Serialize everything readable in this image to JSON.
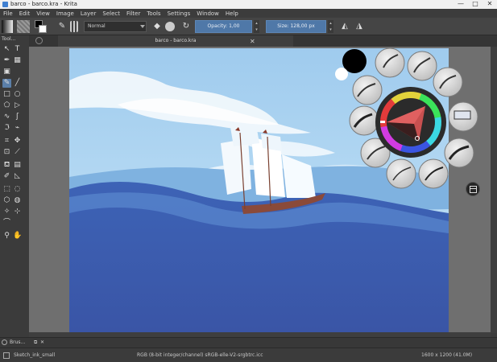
{
  "window": {
    "title": "barco - barco.kra  -  Krita",
    "controls": [
      "—",
      "□",
      "✕"
    ]
  },
  "menu": [
    "File",
    "Edit",
    "View",
    "Image",
    "Layer",
    "Select",
    "Filter",
    "Tools",
    "Settings",
    "Window",
    "Help"
  ],
  "tool_options": {
    "blend_mode": "Normal",
    "opacity_label": "Opacity: 1,00",
    "size_label": "Size: 128,00 px"
  },
  "toolbox": {
    "title": "Tool...",
    "icons": [
      "arrow-select-icon",
      "text-tool-icon",
      "calligraphy-icon",
      "multibrush-icon",
      "transform-icon",
      "brush-tool-icon",
      "line-tool-icon",
      "rectangle-tool-icon",
      "ellipse-tool-icon",
      "polygon-tool-icon",
      "polyline-tool-icon",
      "bezier-tool-icon",
      "freehand-path-icon",
      "dynamic-brush-icon",
      "crop-icon",
      "move-icon",
      "fill-icon",
      "gradient-icon",
      "color-picker-icon",
      "measure-icon",
      "rect-select-icon",
      "ellipse-select-icon",
      "polygon-select-icon",
      "freehand-select-icon",
      "magic-wand-icon",
      "bezier-select-icon",
      "zoom-icon",
      "pan-icon"
    ]
  },
  "document": {
    "tab_title": "barco - barco.kra"
  },
  "bottom_panel": {
    "docker_label": "Brus..."
  },
  "status": {
    "brush_preset": "Sketch_ink_small",
    "color_space": "RGB (8-bit integer/channel)  sRGB-elle-V2-srgbtrc.icc",
    "image_size": "1600 x 1200 (41.0M)"
  },
  "colors": {
    "accent": "#5b7fa9",
    "foreground": "#000000",
    "background": "#ffffff",
    "sea_dark": "#2f4ea6",
    "sky": "#b8dcf4"
  }
}
